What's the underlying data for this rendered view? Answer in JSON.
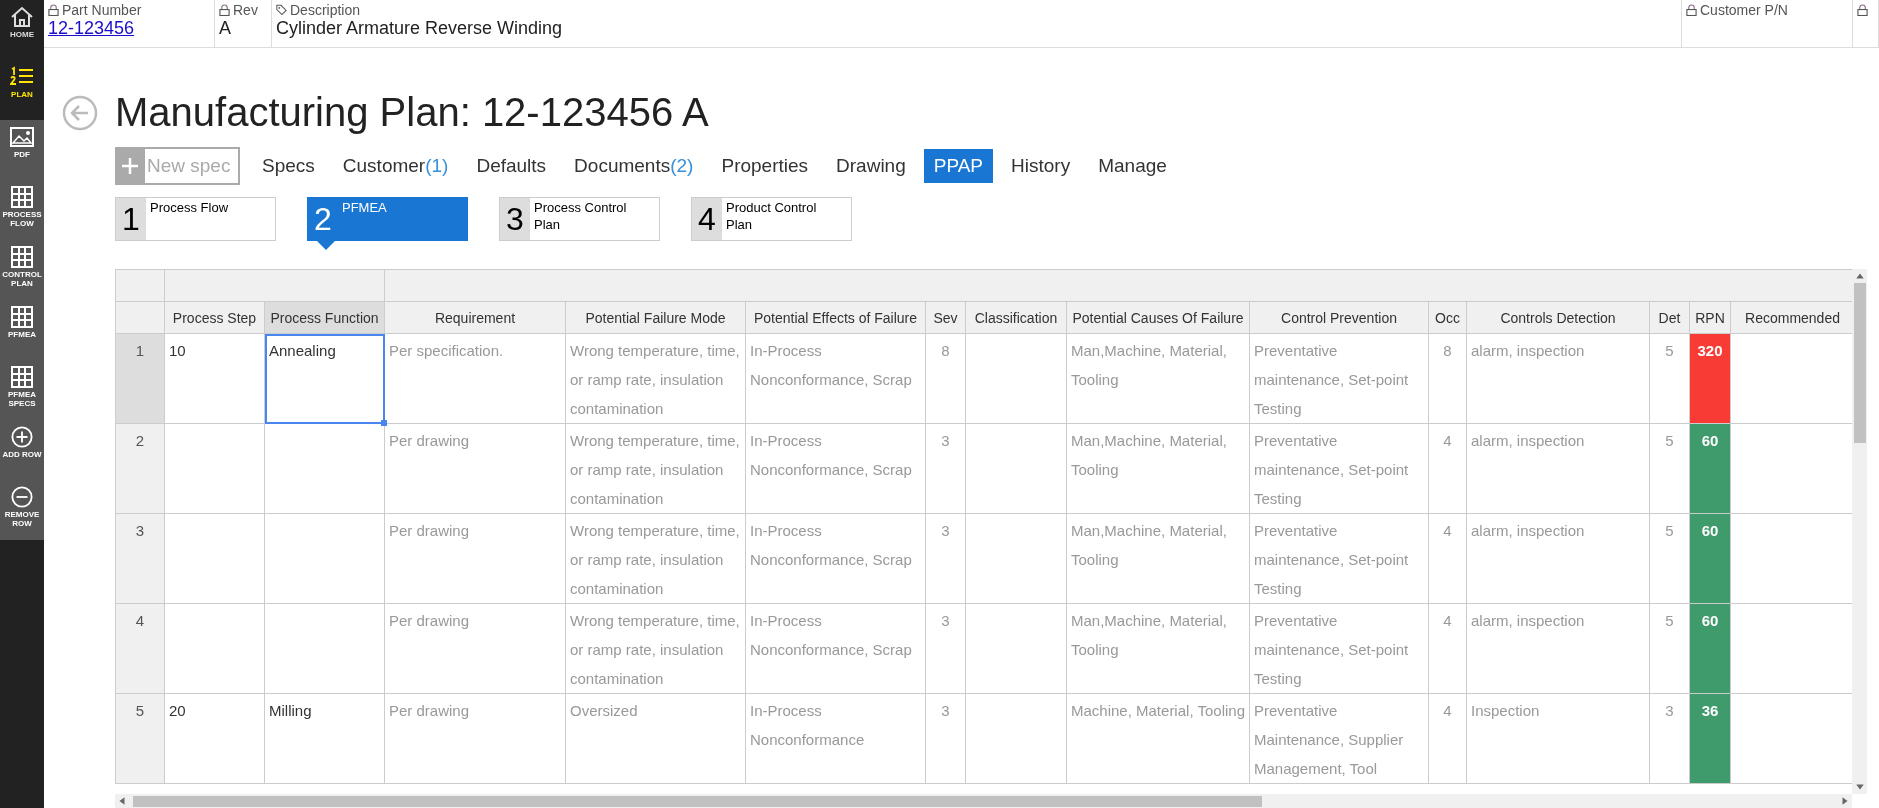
{
  "sidebar": {
    "items": [
      {
        "kind": "home",
        "label": "HOME",
        "selected": false
      },
      {
        "kind": "plan",
        "label": "PLAN",
        "selected": true
      },
      {
        "kind": "pdf",
        "label": "PDF",
        "selected": false
      },
      {
        "kind": "grid",
        "label": "PROCESS FLOW",
        "selected": false
      },
      {
        "kind": "grid",
        "label": "CONTROL PLAN",
        "selected": false
      },
      {
        "kind": "grid",
        "label": "PFMEA",
        "selected": false
      },
      {
        "kind": "grid",
        "label": "PFMEA SPECS",
        "selected": false
      },
      {
        "kind": "add",
        "label": "ADD ROW",
        "selected": false
      },
      {
        "kind": "remove",
        "label": "REMOVE ROW",
        "selected": false
      }
    ]
  },
  "header": {
    "fields": [
      {
        "label": "Part Number",
        "value": "12-123456"
      },
      {
        "label": "Rev",
        "value": "A"
      },
      {
        "label": "Description",
        "value": "Cylinder Armature Reverse Winding"
      },
      {
        "label": "Customer P/N"
      }
    ]
  },
  "title": "Manufacturing Plan: 12-123456 A",
  "new_spec": {
    "placeholder": "New spec"
  },
  "tabs": [
    {
      "label": "Specs",
      "selected": false
    },
    {
      "label": "Customer",
      "count": "(1)",
      "selected": false
    },
    {
      "label": "Defaults",
      "selected": false
    },
    {
      "label": "Documents",
      "count": "(2)",
      "selected": false
    },
    {
      "label": "Properties",
      "selected": false
    },
    {
      "label": "Drawing",
      "selected": false
    },
    {
      "label": "PPAP",
      "selected": true
    },
    {
      "label": "History",
      "selected": false
    },
    {
      "label": "Manage",
      "selected": false
    }
  ],
  "steps": [
    {
      "number": "1",
      "label": "Process Flow",
      "selected": false
    },
    {
      "number": "2",
      "label": "PFMEA",
      "selected": true
    },
    {
      "number": "3",
      "label": "Process Control Plan",
      "selected": false
    },
    {
      "number": "4",
      "label": "Product Control Plan",
      "selected": false
    }
  ],
  "table": {
    "columns": [
      {
        "label": "Process Step",
        "kind": "entry",
        "selected": false
      },
      {
        "label": "Process Function",
        "kind": "entry",
        "selected": true
      },
      {
        "label": "Requirement",
        "kind": "muted",
        "selected": false
      },
      {
        "label": "Potential Failure Mode",
        "kind": "muted",
        "selected": false
      },
      {
        "label": "Potential Effects of Failure",
        "kind": "muted",
        "selected": false
      },
      {
        "label": "Sev",
        "kind": "number",
        "selected": false
      },
      {
        "label": "Classification",
        "kind": "muted",
        "selected": false
      },
      {
        "label": "Potential Causes Of Failure",
        "kind": "muted",
        "selected": false
      },
      {
        "label": "Control Prevention",
        "kind": "muted",
        "selected": false
      },
      {
        "label": "Occ",
        "kind": "number",
        "selected": false
      },
      {
        "label": "Controls Detection",
        "kind": "muted",
        "selected": false
      },
      {
        "label": "Det",
        "kind": "number",
        "selected": false
      },
      {
        "label": "RPN",
        "kind": "rpn",
        "selected": false
      },
      {
        "label": "Recommended",
        "kind": "muted",
        "selected": false
      }
    ],
    "rows": [
      {
        "number": "1",
        "selected": true,
        "color": "#f83c35",
        "cells": [
          "10",
          "Annealing",
          "Per specification.",
          "Wrong temperature, time, or ramp rate, insulation contamination",
          "In-Process Nonconformance, Scrap",
          "8",
          "",
          "Man,Machine, Material, Tooling",
          "Preventative maintenance, Set-point Testing",
          "8",
          "alarm, inspection",
          "5",
          "320",
          ""
        ]
      },
      {
        "number": "2",
        "selected": false,
        "color": "#3f9b6c",
        "cells": [
          "",
          "",
          "Per drawing",
          "Wrong temperature, time, or ramp rate, insulation contamination",
          "In-Process Nonconformance, Scrap",
          "3",
          "",
          "Man,Machine, Material, Tooling",
          "Preventative maintenance, Set-point Testing",
          "4",
          "alarm, inspection",
          "5",
          "60",
          ""
        ]
      },
      {
        "number": "3",
        "selected": false,
        "color": "#3f9b6c",
        "cells": [
          "",
          "",
          "Per drawing",
          "Wrong temperature, time, or ramp rate, insulation contamination",
          "In-Process Nonconformance, Scrap",
          "3",
          "",
          "Man,Machine, Material, Tooling",
          "Preventative maintenance, Set-point Testing",
          "4",
          "alarm, inspection",
          "5",
          "60",
          ""
        ]
      },
      {
        "number": "4",
        "selected": false,
        "color": "#3f9b6c",
        "cells": [
          "",
          "",
          "Per drawing",
          "Wrong temperature, time, or ramp rate, insulation contamination",
          "In-Process Nonconformance, Scrap",
          "3",
          "",
          "Man,Machine, Material, Tooling",
          "Preventative maintenance, Set-point Testing",
          "4",
          "alarm, inspection",
          "5",
          "60",
          ""
        ]
      },
      {
        "number": "5",
        "selected": false,
        "color": "#3f9b6c",
        "cells": [
          "20",
          "Milling",
          "Per drawing",
          "Oversized",
          "In-Process Nonconformance",
          "3",
          "",
          "Machine, Material, Tooling",
          "Preventative Maintenance, Supplier Management, Tool",
          "4",
          "Inspection",
          "3",
          "36",
          ""
        ]
      }
    ]
  }
}
